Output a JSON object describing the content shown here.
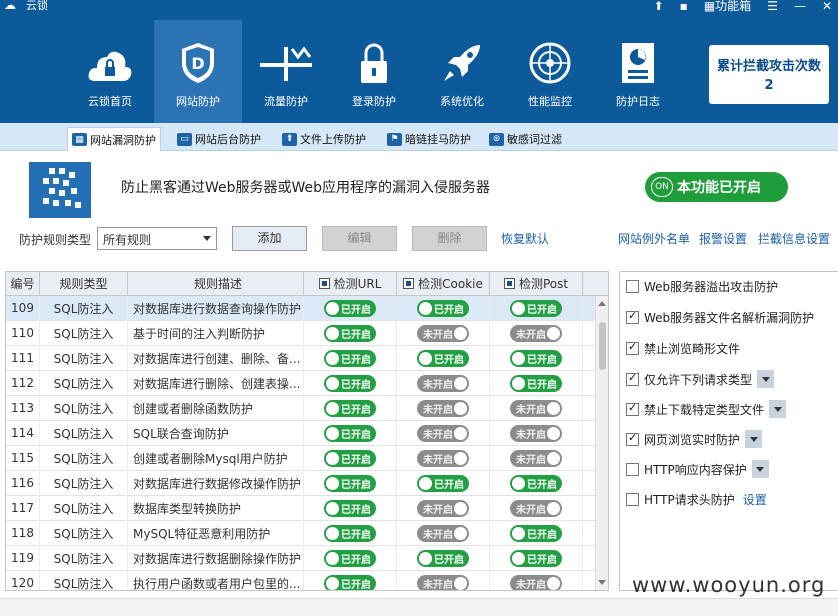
{
  "app": {
    "title": "云锁"
  },
  "titlebar": {
    "toolbox_label": "功能箱"
  },
  "nav": {
    "items": [
      {
        "label": "云锁首页",
        "icon": "lock-cloud-icon"
      },
      {
        "label": "网站防护",
        "icon": "shield-d-icon"
      },
      {
        "label": "流量防护",
        "icon": "traffic-icon"
      },
      {
        "label": "登录防护",
        "icon": "padlock-icon"
      },
      {
        "label": "系统优化",
        "icon": "rocket-icon"
      },
      {
        "label": "性能监控",
        "icon": "radar-icon"
      },
      {
        "label": "防护日志",
        "icon": "log-icon"
      }
    ],
    "active_index": 1
  },
  "counter": {
    "label": "累计拦截攻击次数",
    "value": "2"
  },
  "subtabs": [
    {
      "label": "网站漏洞防护",
      "icon": "grid-icon",
      "active": true
    },
    {
      "label": "网站后台防护",
      "icon": "screen-icon"
    },
    {
      "label": "文件上传防护",
      "icon": "upload-shield-icon"
    },
    {
      "label": "暗链挂马防护",
      "icon": "flag-icon"
    },
    {
      "label": "敏感词过滤",
      "icon": "filter-icon"
    }
  ],
  "banner": {
    "description": "防止黑客通过Web服务器或Web应用程序的漏洞入侵服务器",
    "status_label": "本功能已开启",
    "status_badge": "ON"
  },
  "controls": {
    "rule_type_label": "防护规则类型",
    "rule_type_value": "所有规则",
    "add_label": "添加",
    "edit_label": "编辑",
    "delete_label": "删除",
    "restore_label": "恢复默认",
    "whitelist_label": "网站例外名单",
    "alarm_label": "报警设置",
    "block_info_label": "拦截信息设置"
  },
  "table": {
    "headers": [
      "编号",
      "规则类型",
      "规则描述",
      "检测URL",
      "检测Cookie",
      "检测Post"
    ],
    "on_label": "已开启",
    "off_label": "未开启",
    "rows": [
      {
        "id": "109",
        "type": "SQL防注入",
        "desc": "对数据库进行数据查询操作防护",
        "url": true,
        "cookie": true,
        "post": true
      },
      {
        "id": "110",
        "type": "SQL防注入",
        "desc": "基于时间的注入判断防护",
        "url": true,
        "cookie": false,
        "post": false
      },
      {
        "id": "111",
        "type": "SQL防注入",
        "desc": "对数据库进行创建、删除、备...",
        "url": true,
        "cookie": true,
        "post": true
      },
      {
        "id": "112",
        "type": "SQL防注入",
        "desc": "对数据库进行删除、创建表操...",
        "url": true,
        "cookie": false,
        "post": true
      },
      {
        "id": "113",
        "type": "SQL防注入",
        "desc": "创建或者删除函数防护",
        "url": true,
        "cookie": false,
        "post": false
      },
      {
        "id": "114",
        "type": "SQL防注入",
        "desc": "SQL联合查询防护",
        "url": true,
        "cookie": false,
        "post": false
      },
      {
        "id": "115",
        "type": "SQL防注入",
        "desc": "创建或者删除Mysql用户防护",
        "url": true,
        "cookie": false,
        "post": false
      },
      {
        "id": "116",
        "type": "SQL防注入",
        "desc": "对数据库进行数据修改操作防护",
        "url": true,
        "cookie": true,
        "post": true
      },
      {
        "id": "117",
        "type": "SQL防注入",
        "desc": "数据库类型转换防护",
        "url": true,
        "cookie": false,
        "post": false
      },
      {
        "id": "118",
        "type": "SQL防注入",
        "desc": "MySQL特征恶意利用防护",
        "url": true,
        "cookie": false,
        "post": true
      },
      {
        "id": "119",
        "type": "SQL防注入",
        "desc": "对数据库进行数据删除操作防护",
        "url": true,
        "cookie": true,
        "post": true
      },
      {
        "id": "120",
        "type": "SQL防注入",
        "desc": "执行用户函数或者用户包里的...",
        "url": true,
        "cookie": false,
        "post": false
      }
    ]
  },
  "options": [
    {
      "label": "Web服务器溢出攻击防护",
      "checked": false
    },
    {
      "label": "Web服务器文件名解析漏洞防护",
      "checked": true
    },
    {
      "label": "禁止浏览畸形文件",
      "checked": true
    },
    {
      "label": "仅允许下列请求类型",
      "checked": true,
      "dropdown": true
    },
    {
      "label": "禁止下载特定类型文件",
      "checked": true,
      "dropdown": true
    },
    {
      "label": "网页浏览实时防护",
      "checked": true,
      "dropdown": true
    },
    {
      "label": "HTTP响应内容保护",
      "checked": false,
      "dropdown": true
    },
    {
      "label": "HTTP请求头防护",
      "checked": false,
      "link": "设置"
    }
  ],
  "watermark": "www.wooyun.org"
}
